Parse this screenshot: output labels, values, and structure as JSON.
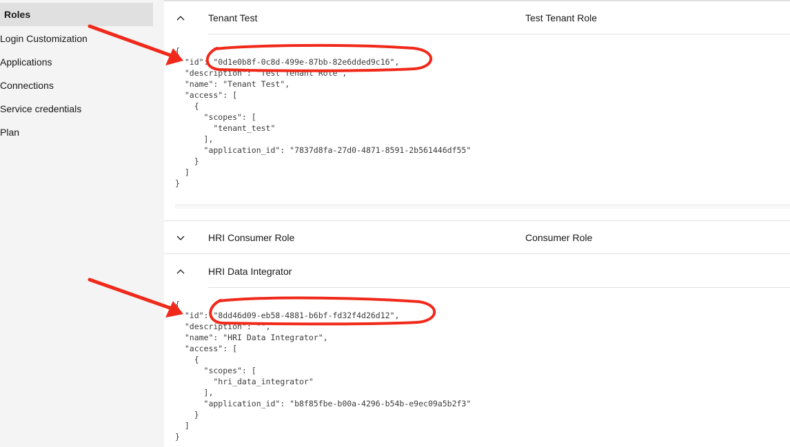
{
  "sidebar": {
    "items": [
      {
        "label": "Roles",
        "active": true
      },
      {
        "label": "Login Customization",
        "active": false
      },
      {
        "label": "Applications",
        "active": false
      },
      {
        "label": "Connections",
        "active": false
      },
      {
        "label": "Service credentials",
        "active": false
      },
      {
        "label": "Plan",
        "active": false
      }
    ]
  },
  "roles": [
    {
      "name": "Tenant Test",
      "description": "Test Tenant Role",
      "expanded": true,
      "chevron": "chevron-up-icon",
      "json_lines": [
        "{",
        "  \"id\": \"0d1e0b8f-0c8d-499e-87bb-82e6dded9c16\",",
        "  \"description\": \"Test Tenant Role\",",
        "  \"name\": \"Tenant Test\",",
        "  \"access\": [",
        "    {",
        "      \"scopes\": [",
        "        \"tenant_test\"",
        "      ],",
        "      \"application_id\": \"7837d8fa-27d0-4871-8591-2b561446df55\"",
        "    }",
        "  ]",
        "}"
      ]
    },
    {
      "name": "HRI Consumer Role",
      "description": "Consumer Role",
      "expanded": false,
      "chevron": "chevron-down-icon"
    },
    {
      "name": "HRI Data Integrator",
      "description": "",
      "expanded": true,
      "chevron": "chevron-up-icon",
      "json_lines": [
        "{",
        "  \"id\": \"8dd46d09-eb58-4881-b6bf-fd32f4d26d12\",",
        "  \"description\": \"\",",
        "  \"name\": \"HRI Data Integrator\",",
        "  \"access\": [",
        "    {",
        "      \"scopes\": [",
        "        \"hri_data_integrator\"",
        "      ],",
        "      \"application_id\": \"b8f85fbe-b00a-4296-b54b-e9ec09a5b2f3\"",
        "    }",
        "  ]",
        "}"
      ]
    }
  ],
  "annotations": {
    "color": "#f0291a",
    "items": [
      "arrow-to-tenant-test-id",
      "circle-tenant-test-id",
      "arrow-to-hri-data-integrator-id",
      "circle-hri-data-integrator-id"
    ]
  }
}
